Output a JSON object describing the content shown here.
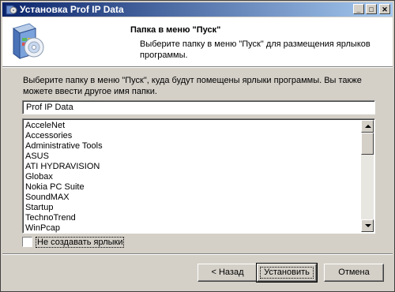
{
  "window": {
    "title": "Установка Prof IP Data",
    "buttons": {
      "minimize": "_",
      "maximize": "□",
      "close": "✕"
    }
  },
  "header": {
    "title": "Папка в меню \"Пуск\"",
    "subtitle": "Выберите папку в меню \"Пуск\" для размещения ярлыков программы."
  },
  "body": {
    "description": "Выберите папку в меню \"Пуск\", куда будут помещены ярлыки программы. Вы также можете ввести другое имя папки.",
    "folder_name": "Prof IP Data",
    "folders": [
      "AcceleNet",
      "Accessories",
      "Administrative Tools",
      "ASUS",
      "ATI HYDRAVISION",
      "Globax",
      "Nokia PC Suite",
      "SoundMAX",
      "Startup",
      "TechnoTrend",
      "WinPcap"
    ],
    "no_shortcuts_label": "Не создавать ярлыки",
    "no_shortcuts_checked": false
  },
  "footer": {
    "back_label": "< Назад",
    "install_label": "Установить",
    "cancel_label": "Отмена"
  },
  "colors": {
    "titlebar_start": "#0a246a",
    "titlebar_end": "#a6caf0",
    "face": "#d4d0c8"
  },
  "icons": {
    "title_icon": "installer-icon",
    "header_logo": "installer-cd-box-icon"
  }
}
